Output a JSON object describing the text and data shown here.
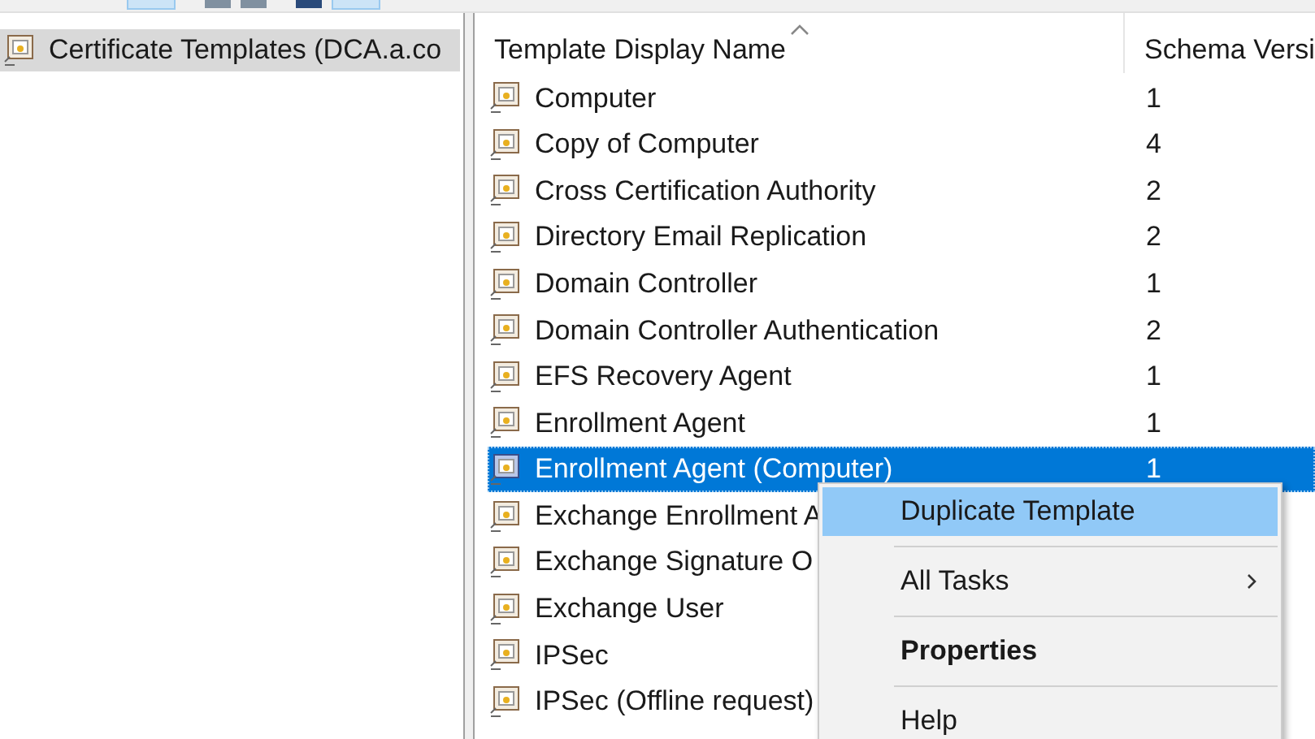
{
  "tree": {
    "items": [
      {
        "label": "Certificate Templates (DCA.a.co",
        "selected": true
      }
    ]
  },
  "table": {
    "columns": [
      {
        "label": "Template Display Name",
        "sorted": true
      },
      {
        "label": "Schema Versi",
        "sorted": false
      }
    ],
    "rows": [
      {
        "name": "Computer",
        "schema": "1",
        "selected": false
      },
      {
        "name": "Copy of Computer",
        "schema": "4",
        "selected": false
      },
      {
        "name": "Cross Certification Authority",
        "schema": "2",
        "selected": false
      },
      {
        "name": "Directory Email Replication",
        "schema": "2",
        "selected": false
      },
      {
        "name": "Domain Controller",
        "schema": "1",
        "selected": false
      },
      {
        "name": "Domain Controller Authentication",
        "schema": "2",
        "selected": false
      },
      {
        "name": "EFS Recovery Agent",
        "schema": "1",
        "selected": false
      },
      {
        "name": "Enrollment Agent",
        "schema": "1",
        "selected": false
      },
      {
        "name": "Enrollment Agent (Computer)",
        "schema": "1",
        "selected": true
      },
      {
        "name": "Exchange Enrollment A",
        "selected": false
      },
      {
        "name": "Exchange Signature O",
        "selected": false
      },
      {
        "name": "Exchange User",
        "selected": false
      },
      {
        "name": "IPSec",
        "selected": false
      },
      {
        "name": "IPSec (Offline request)",
        "selected": false
      }
    ]
  },
  "context_menu": {
    "items": [
      {
        "label": "Duplicate Template",
        "selected": true,
        "bold": false,
        "submenu": false
      },
      {
        "label": "All Tasks",
        "selected": false,
        "bold": false,
        "submenu": true
      },
      {
        "label": "Properties",
        "selected": false,
        "bold": true,
        "submenu": false
      },
      {
        "label": "Help",
        "selected": false,
        "bold": false,
        "submenu": false
      }
    ]
  }
}
